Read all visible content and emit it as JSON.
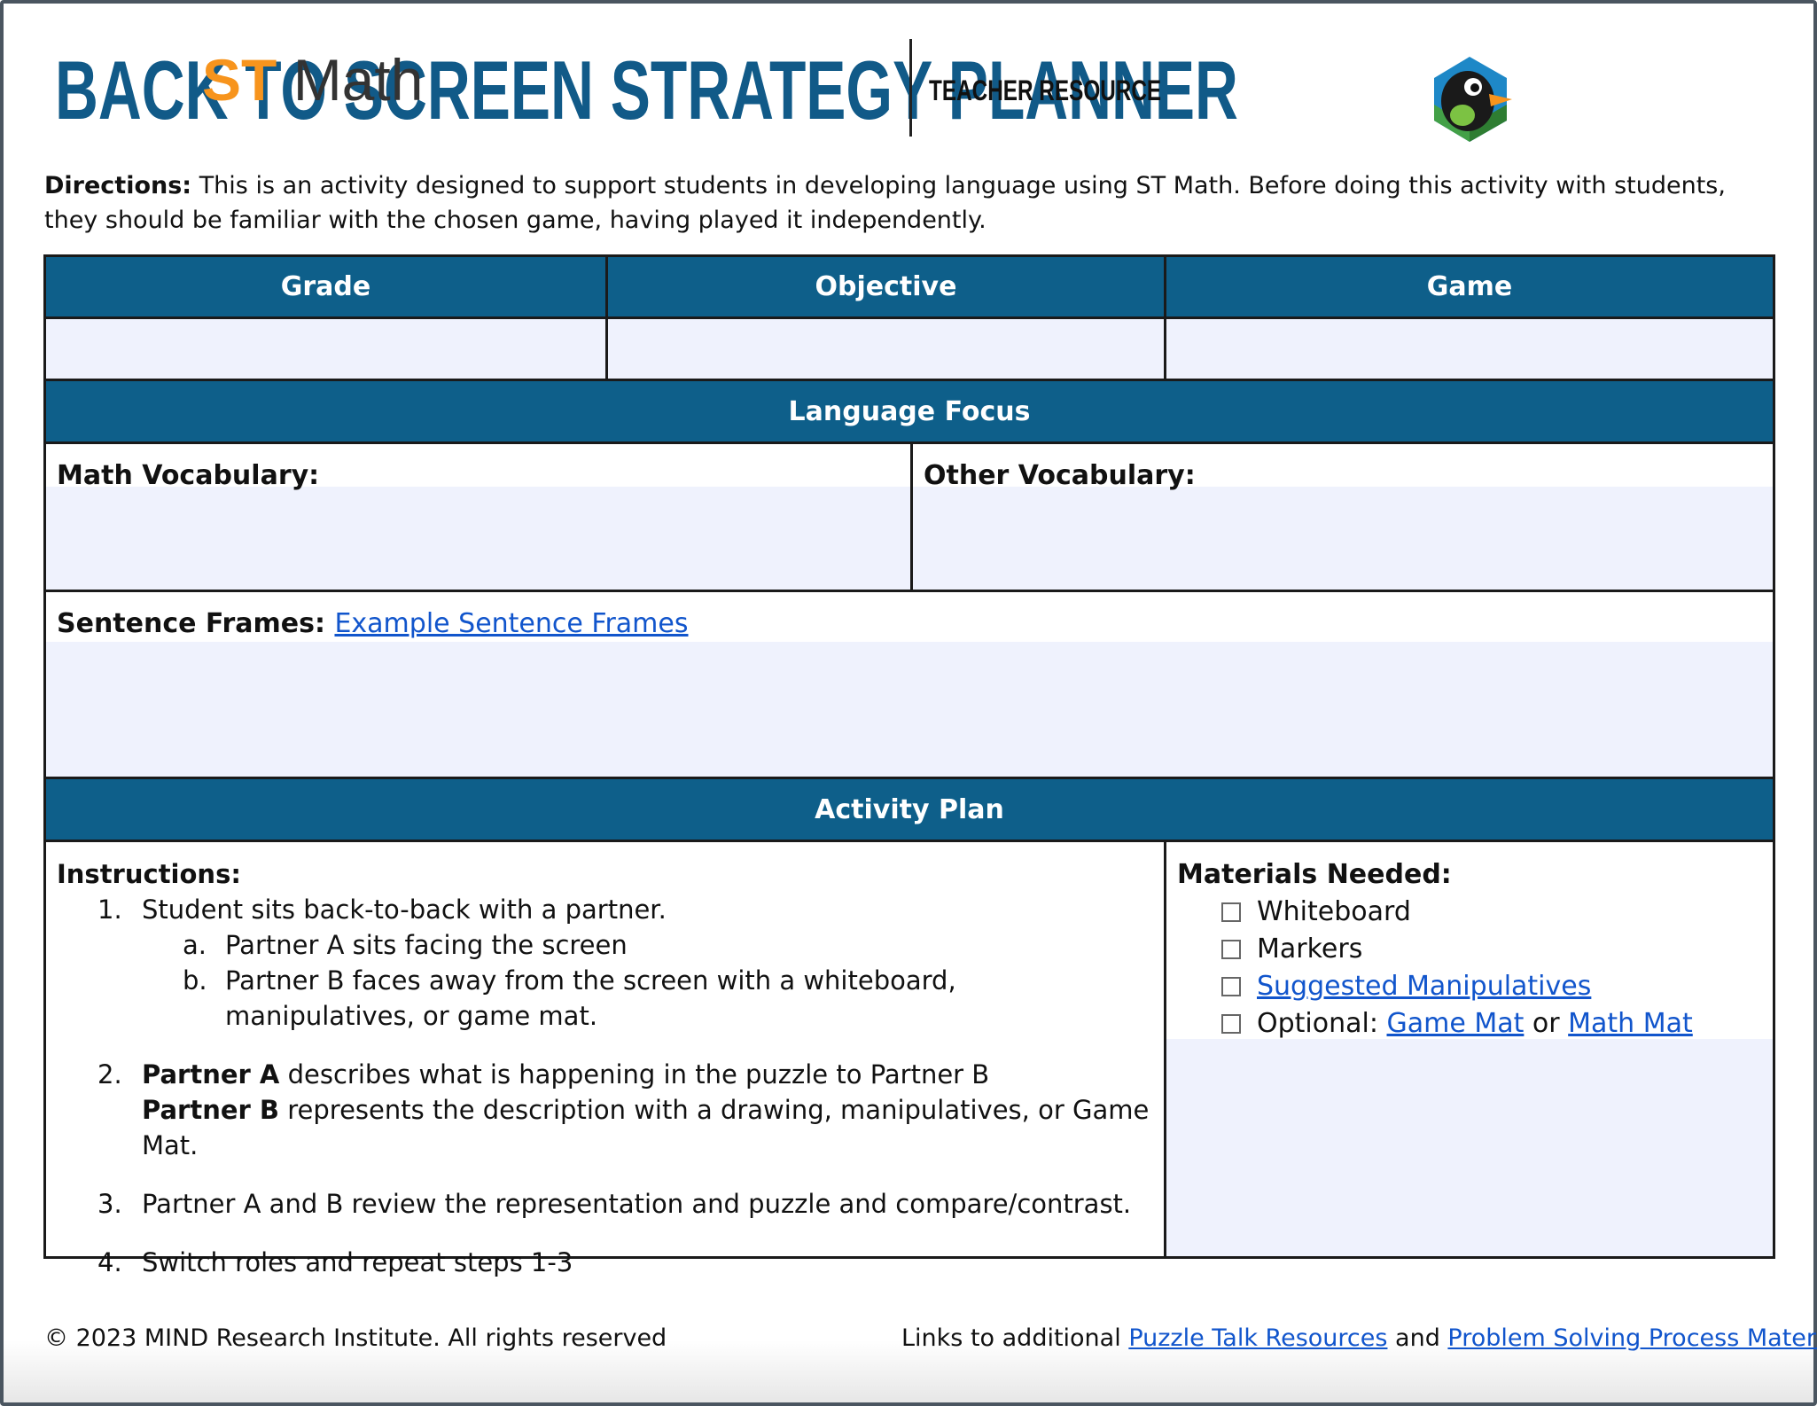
{
  "header": {
    "title": "BACK TO SCREEN STRATEGY PLANNER",
    "subtitle": "TEACHER RESOURCE",
    "logo_st": "ST",
    "logo_math": "Math"
  },
  "directions": {
    "label": "Directions:",
    "text": " This is an activity designed to support students in developing language using ST Math. Before doing this activity with students, they should be familiar with the chosen game, having played it independently."
  },
  "table": {
    "headers": [
      "Grade",
      "Objective",
      "Game"
    ],
    "language_focus": "Language Focus",
    "math_vocab_label": "Math Vocabulary:",
    "other_vocab_label": "Other Vocabulary:",
    "sentence_frames_label": "Sentence Frames:",
    "sentence_frames_link": "Example Sentence Frames",
    "activity_plan": "Activity Plan"
  },
  "instructions": {
    "heading": "Instructions:",
    "step1": "Student sits back-to-back with a partner.",
    "step1a": "Partner A sits facing the screen",
    "step1b": "Partner B faces away from the screen with a whiteboard, manipulatives, or game mat.",
    "step2_bold1": "Partner A",
    "step2_text1": " describes what is happening in the puzzle to Partner B",
    "step2_bold2": "Partner B",
    "step2_text2": " represents the description with a drawing, manipulatives, or Game Mat.",
    "step3": "Partner A and B review the representation and puzzle and compare/contrast.",
    "step4": "Switch roles and repeat steps 1-3",
    "nums": [
      "1.",
      "a.",
      "b.",
      "2.",
      "3.",
      "4."
    ]
  },
  "materials": {
    "heading": "Materials Needed:",
    "item1": "Whiteboard",
    "item2": "Markers",
    "item3_link": "Suggested Manipulatives",
    "item4_prefix": "Optional: ",
    "item4_link1": "Game Mat",
    "item4_mid": " or ",
    "item4_link2": "Math Mat"
  },
  "footer": {
    "copyright": "© 2023 MIND Research Institute. All rights reserved",
    "links_prefix": "Links to additional ",
    "link1": "Puzzle Talk Resources",
    "links_mid": " and ",
    "link2": "Problem Solving Process Materials"
  },
  "colors": {
    "header_blue": "#0e5f8a",
    "title_blue": "#115a88",
    "fill": "#eff2fd",
    "link": "#1155cc",
    "logo_orange": "#f7941d"
  }
}
